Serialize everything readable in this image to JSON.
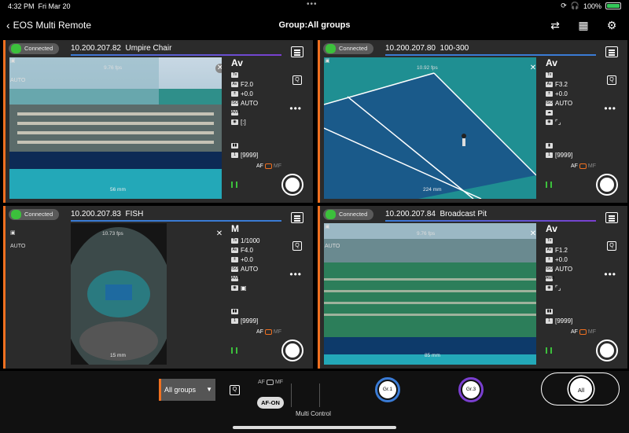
{
  "status": {
    "time": "4:32 PM",
    "date": "Fri Mar 20",
    "battery": "100%",
    "battery_level": 1.0
  },
  "header": {
    "back_label": "EOS Multi Remote",
    "title": "Group:All groups"
  },
  "cameras": [
    {
      "connected": "Connected",
      "ip": "10.200.207.82",
      "name": "Umpire Chair",
      "fps": "9.76 fps",
      "focal": "56 mm",
      "mode": "Av",
      "shutter": "",
      "aperture": "F2.0",
      "exposure": "+0.0",
      "iso": "AUTO",
      "shots": "[9999]",
      "auto": "AUTO"
    },
    {
      "connected": "Connected",
      "ip": "10.200.207.80",
      "name": "100-300",
      "fps": "10.92 fps",
      "focal": "224 mm",
      "mode": "Av",
      "shutter": "",
      "aperture": "F3.2",
      "exposure": "+0.0",
      "iso": "AUTO",
      "shots": "[9999]",
      "auto": ""
    },
    {
      "connected": "Connected",
      "ip": "10.200.207.83",
      "name": "FISH",
      "fps": "10.73 fps",
      "focal": "15 mm",
      "mode": "M",
      "shutter": "1/1000",
      "aperture": "F4.0",
      "exposure": "+0.0",
      "iso": "AUTO",
      "shots": "[9999]",
      "auto": "AUTO"
    },
    {
      "connected": "Connected",
      "ip": "10.200.207.84",
      "name": "Broadcast Pit",
      "fps": "9.76 fps",
      "focal": "85 mm",
      "mode": "Av",
      "shutter": "",
      "aperture": "F1.2",
      "exposure": "+0.0",
      "iso": "AUTO",
      "shots": "[9999]",
      "auto": "AUTO"
    }
  ],
  "panel_labels": {
    "af": "AF",
    "mf": "MF"
  },
  "bottom": {
    "group_select": "All groups",
    "af_label": "AF",
    "mf_label": "MF",
    "af_on": "AF-ON",
    "multi_control": "Multi Control",
    "gr1": "Gr.1",
    "gr3": "Gr.3",
    "all": "All"
  },
  "colors": {
    "accent": "#f07020",
    "connected": "#3cc03c",
    "gr1": "#3a7bd5",
    "gr3": "#7a3fd0"
  }
}
